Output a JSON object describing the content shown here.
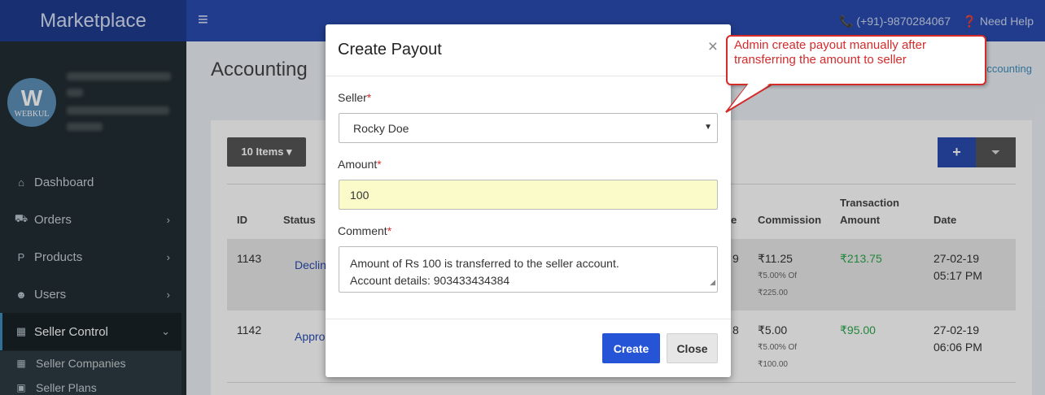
{
  "brand": "Marketplace",
  "avatar": {
    "mark": "W",
    "text": "WEBKUL"
  },
  "sidebar": {
    "items": [
      {
        "icon": "⌂",
        "label": "Dashboard"
      },
      {
        "icon": "⛟",
        "label": "Orders",
        "chevron": "›"
      },
      {
        "icon": "P",
        "label": "Products",
        "chevron": "›"
      },
      {
        "icon": "☻",
        "label": "Users",
        "chevron": "›"
      },
      {
        "icon": "▦",
        "label": "Seller Control",
        "chevron": "⌄"
      }
    ],
    "subitems": [
      {
        "icon": "▦",
        "label": "Seller Companies"
      },
      {
        "icon": "▣",
        "label": "Seller Plans"
      }
    ]
  },
  "topbar": {
    "menu_icon": "≡",
    "phone": "📞 (+91)-9870284067",
    "help": "❓ Need Help"
  },
  "content": {
    "title": "Accounting",
    "breadcrumb": "ccounting",
    "items_button": "10 Items ▾",
    "add_button": "+",
    "filter_icon": "⏷"
  },
  "table": {
    "headers": {
      "id": "ID",
      "status": "Status",
      "partial": "e",
      "commission": "Commission",
      "transaction_line1": "Transaction",
      "transaction_line2": "Amount",
      "date": "Date"
    },
    "rows": [
      {
        "id": "1143",
        "status": "Declin",
        "partial": "9",
        "commission": "₹11.25",
        "commission_pct": "₹5.00% Of",
        "commission_of": "₹225.00",
        "amount": "₹213.75",
        "date": "27-02-19",
        "time": "05:17 PM"
      },
      {
        "id": "1142",
        "status": "Appro",
        "partial": "8",
        "commission": "₹5.00",
        "commission_pct": "₹5.00% Of",
        "commission_of": "₹100.00",
        "amount": "₹95.00",
        "date": "27-02-19",
        "time": "06:06 PM"
      }
    ]
  },
  "modal": {
    "title": "Create Payout",
    "close_x": "×",
    "seller_label": "Seller",
    "seller_value": "Rocky Doe",
    "seller_caret": "▼",
    "amount_label": "Amount",
    "amount_value": "100",
    "comment_label": "Comment",
    "comment_line1": "Amount of Rs 100 is transferred to the seller account.",
    "comment_line2": "Account details: 903433434384",
    "required_mark": "*",
    "create_button": "Create",
    "close_button": "Close"
  },
  "callout": {
    "line1": "Admin create payout manually after",
    "line2": "transferring the amount to seller"
  }
}
